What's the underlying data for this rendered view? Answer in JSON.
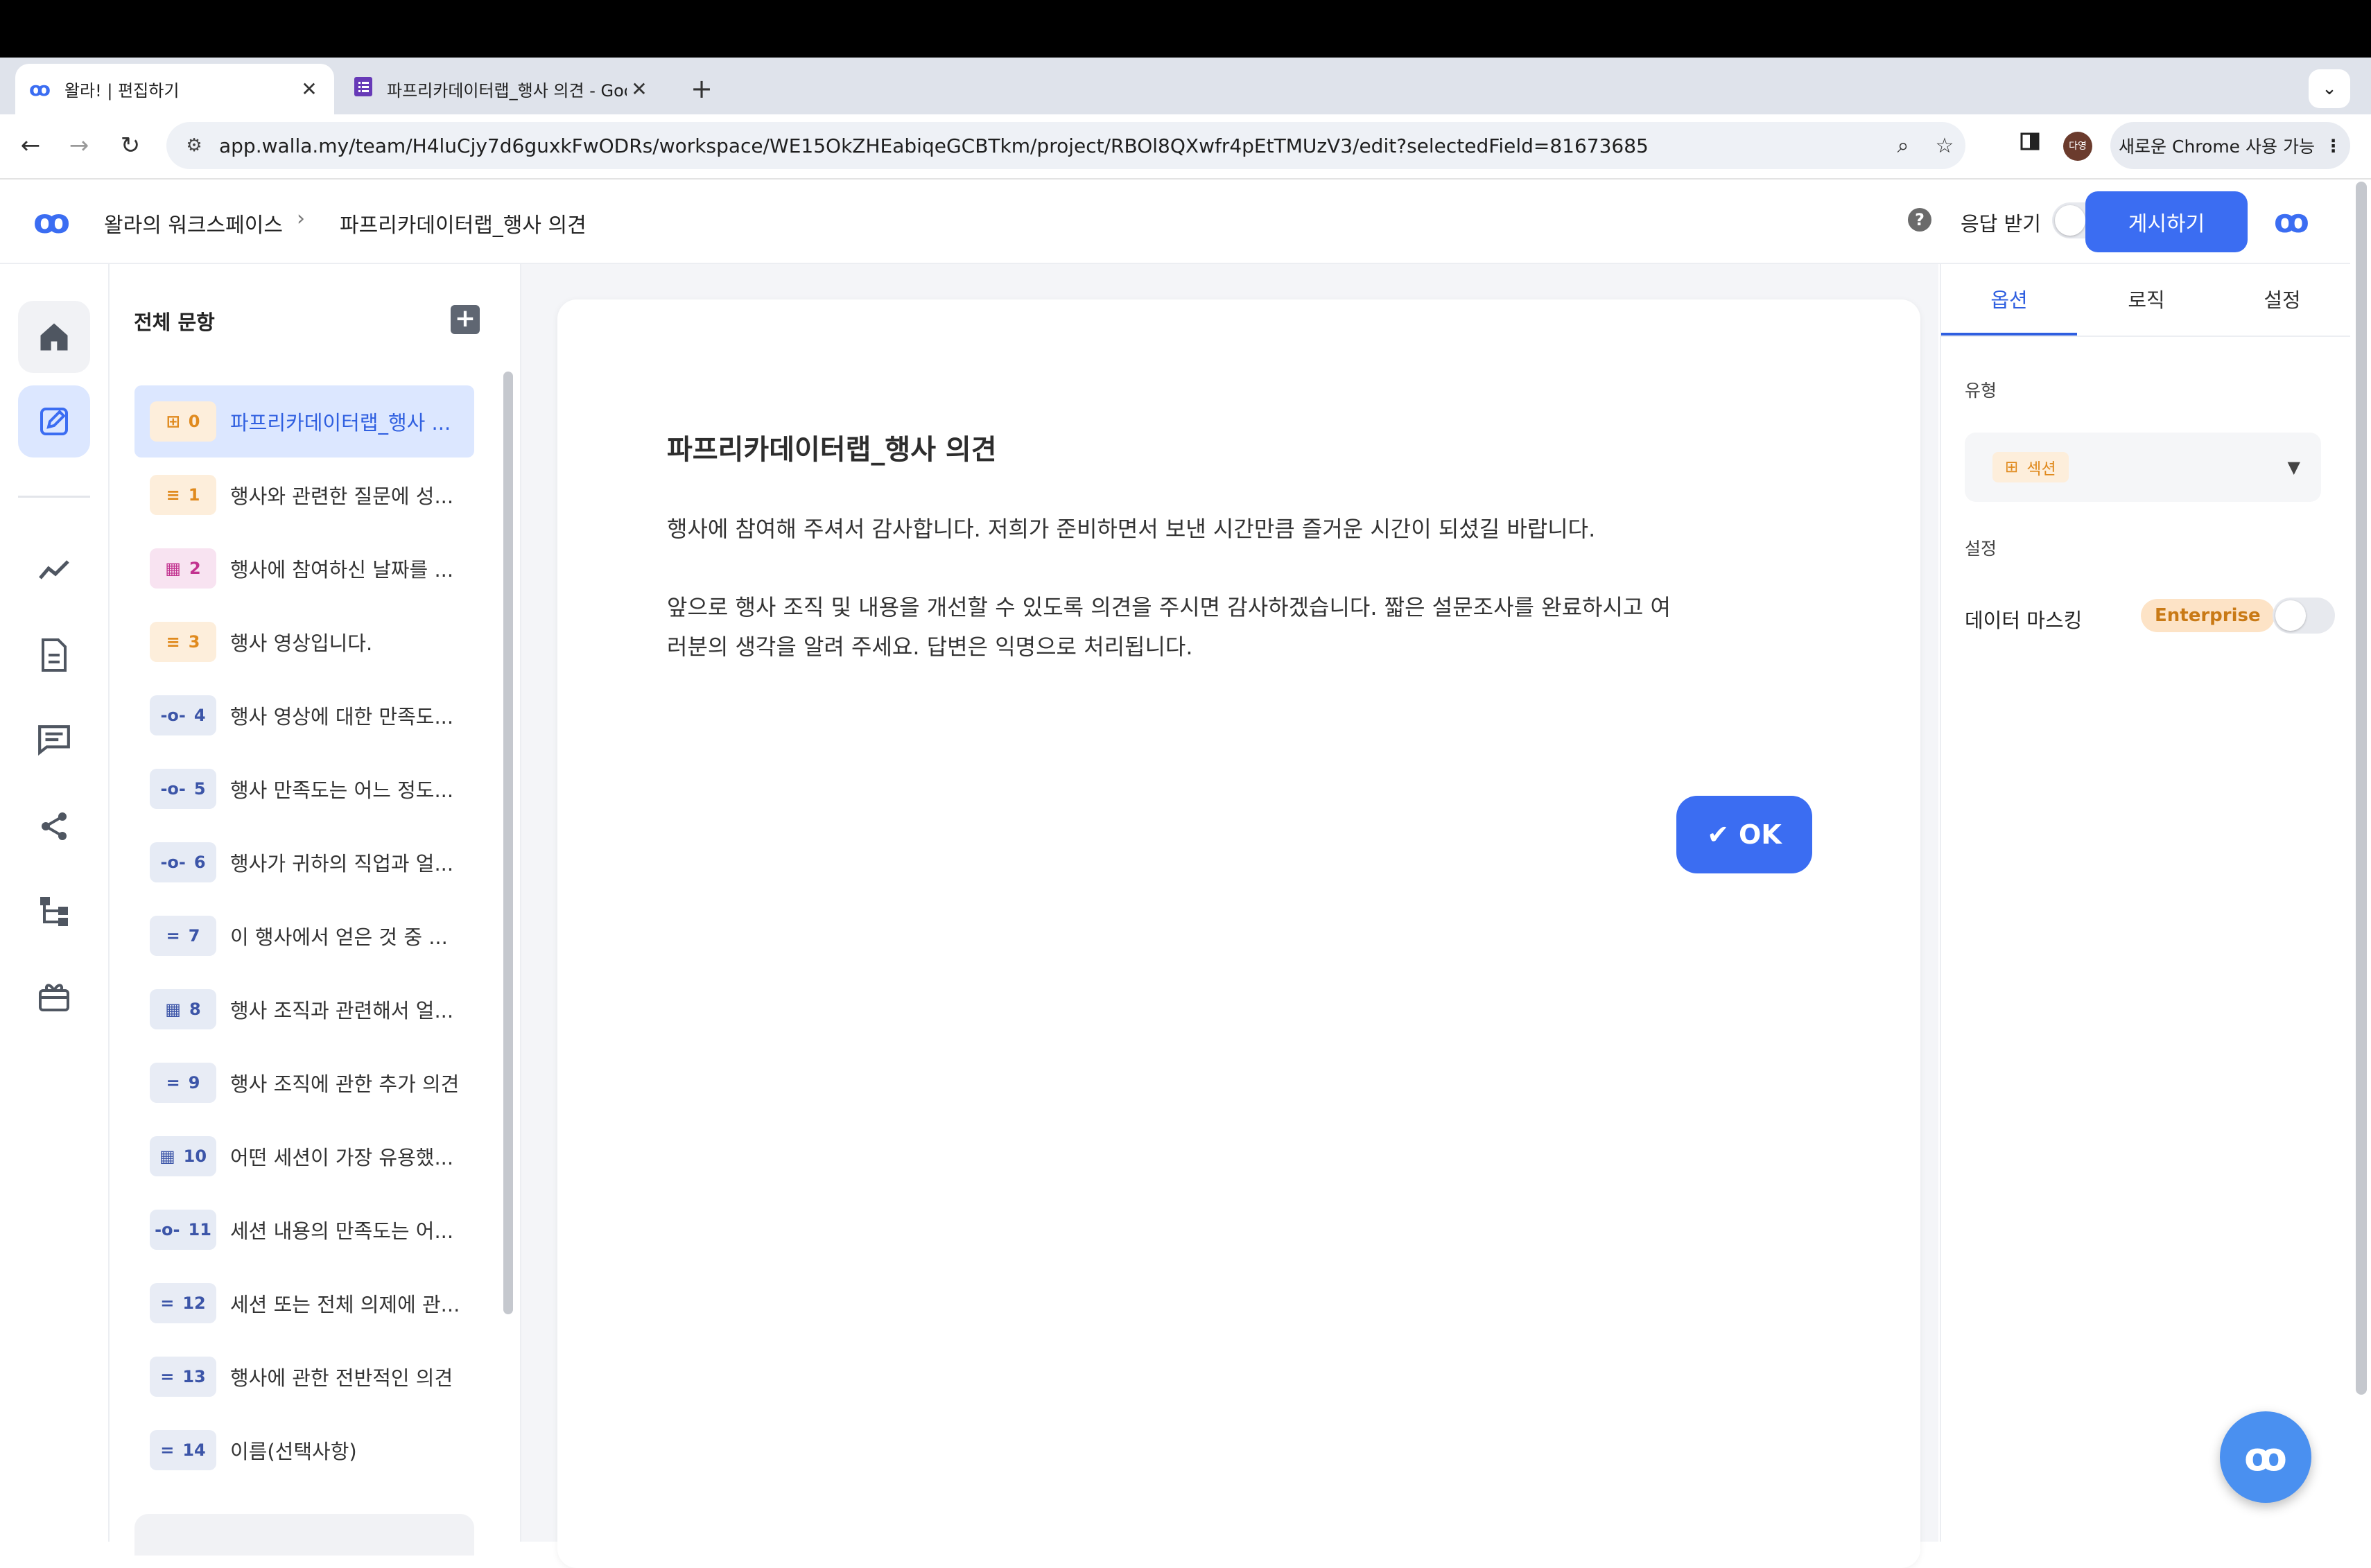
{
  "browser": {
    "tabs": [
      {
        "title": "왈라! | 편집하기",
        "icon": "walla-logo-icon",
        "active": true
      },
      {
        "title": "파프리카데이터랩_행사 의견 - Goo",
        "icon": "google-forms-icon",
        "active": false
      }
    ],
    "url": "app.walla.my/team/H4luCjy7d6guxkFwODRs/workspace/WE15OkZHEabiqeGCBTkm/project/RBOl8QXwfr4pEtTMUzV3/edit?selectedField=81673685",
    "profile_initials": "다영",
    "chrome_notice": "새로운 Chrome 사용 가능"
  },
  "header": {
    "logo": "ꝏ",
    "breadcrumb": [
      "왈라의 워크스페이스",
      "파프리카데이터랩_행사 의견"
    ],
    "breadcrumb_sep": "›",
    "responses_label": "응답 받기",
    "publish_label": "게시하기"
  },
  "question_panel": {
    "title": "전체 문항",
    "items": [
      {
        "num": "0",
        "label": "파프리카데이터랩_행사 ...",
        "kind": "section",
        "icon": "section-icon",
        "selected": true
      },
      {
        "num": "1",
        "label": "행사와 관련한 질문에 성...",
        "kind": "statement",
        "icon": "text-lines-icon",
        "selected": false
      },
      {
        "num": "2",
        "label": "행사에 참여하신 날짜를 ...",
        "kind": "date",
        "icon": "calendar-icon",
        "selected": false
      },
      {
        "num": "3",
        "label": "행사 영상입니다.",
        "kind": "statement",
        "icon": "text-lines-icon",
        "selected": false
      },
      {
        "num": "4",
        "label": "행사 영상에 대한 만족도...",
        "kind": "scale",
        "icon": "slider-icon",
        "selected": false
      },
      {
        "num": "5",
        "label": "행사 만족도는 어느 정도...",
        "kind": "scale",
        "icon": "slider-icon",
        "selected": false
      },
      {
        "num": "6",
        "label": "행사가 귀하의 직업과 얼...",
        "kind": "scale",
        "icon": "slider-icon",
        "selected": false
      },
      {
        "num": "7",
        "label": "이 행사에서 얻은 것 중 ...",
        "kind": "short",
        "icon": "short-text-icon",
        "selected": false
      },
      {
        "num": "8",
        "label": "행사 조직과 관련해서 얼...",
        "kind": "grid",
        "icon": "grid-icon",
        "selected": false
      },
      {
        "num": "9",
        "label": "행사 조직에 관한 추가 의견",
        "kind": "short",
        "icon": "short-text-icon",
        "selected": false
      },
      {
        "num": "10",
        "label": "어떤 세션이 가장 유용했...",
        "kind": "grid",
        "icon": "grid-icon",
        "selected": false
      },
      {
        "num": "11",
        "label": "세션 내용의 만족도는 어...",
        "kind": "scale",
        "icon": "slider-icon",
        "selected": false
      },
      {
        "num": "12",
        "label": "세션 또는 전체 의제에 관...",
        "kind": "short",
        "icon": "short-text-icon",
        "selected": false
      },
      {
        "num": "13",
        "label": "행사에 관한 전반적인 의견",
        "kind": "short",
        "icon": "short-text-icon",
        "selected": false
      },
      {
        "num": "14",
        "label": "이름(선택사항)",
        "kind": "short",
        "icon": "short-text-icon",
        "selected": false
      }
    ]
  },
  "canvas": {
    "title": "파프리카데이터랩_행사 의견",
    "description_1": "행사에 참여해 주셔서 감사합니다. 저희가 준비하면서 보낸 시간만큼 즐거운 시간이 되셨길 바랍니다.",
    "description_2": "앞으로 행사 조직 및 내용을 개선할 수 있도록 의견을 주시면 감사하겠습니다. 짧은 설문조사를 완료하시고 여러분의 생각을 알려 주세요. 답변은 익명으로 처리됩니다.",
    "ok_label": "OK",
    "ok_icon": "checkmark-icon"
  },
  "right_panel": {
    "tabs": [
      "옵션",
      "로직",
      "설정"
    ],
    "active_tab": "옵션",
    "type_label": "유형",
    "type_value": "섹션",
    "settings_label": "설정",
    "masking_label": "데이터 마스킹",
    "enterprise_badge": "Enterprise",
    "masking_enabled": false
  },
  "colors": {
    "accent": "#3b6df2",
    "selected_bg": "#dce7ff",
    "section_badge": "#e08a1e",
    "date_badge": "#c2328f",
    "enterprise_badge": "#c97a16"
  }
}
